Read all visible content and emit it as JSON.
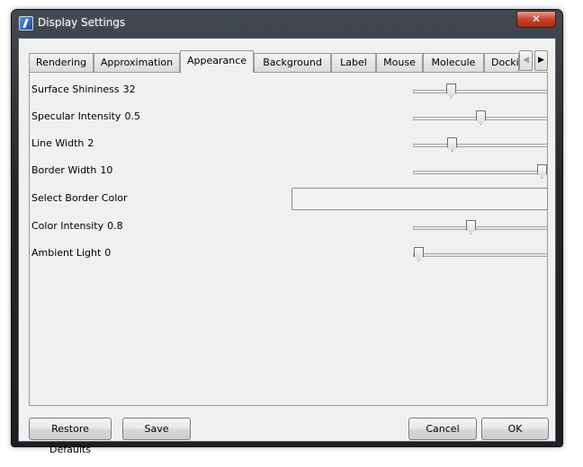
{
  "window": {
    "title": "Display Settings",
    "close_glyph": "✕"
  },
  "tabs": [
    {
      "label": "Rendering"
    },
    {
      "label": "Approximation"
    },
    {
      "label": "Appearance"
    },
    {
      "label": "Background"
    },
    {
      "label": "Label"
    },
    {
      "label": "Mouse"
    },
    {
      "label": "Molecule"
    },
    {
      "label": "Docki"
    }
  ],
  "active_tab": "Appearance",
  "tab_scroll": {
    "left_glyph": "◀",
    "right_glyph": "▶"
  },
  "settings": [
    {
      "label": "Surface Shininess",
      "value": "32",
      "level": 0.26
    },
    {
      "label": "Specular Intensity",
      "value": "0.5",
      "level": 0.5
    },
    {
      "label": "Line Width",
      "value": "2",
      "level": 0.27
    },
    {
      "label": "Border Width",
      "value": "10",
      "level": 1.0
    },
    {
      "label": "Select Border Color"
    },
    {
      "label": "Color Intensity",
      "value": "0.8",
      "level": 0.42
    },
    {
      "label": "Ambient Light",
      "value": "0",
      "level": 0.0
    }
  ],
  "buttons": {
    "restore_defaults": "Restore Defaults",
    "save": "Save",
    "cancel": "Cancel",
    "ok": "OK"
  }
}
